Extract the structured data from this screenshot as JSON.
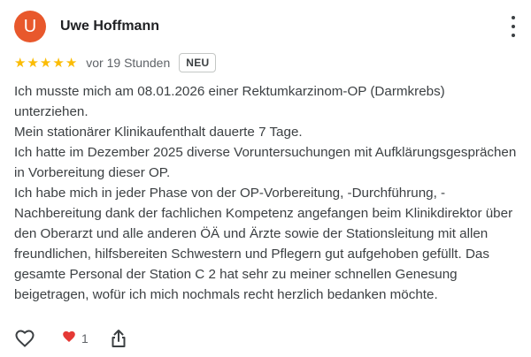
{
  "review": {
    "author_initial": "U",
    "author_name": "Uwe Hoffmann",
    "avatar_color": "#e8582c",
    "rating": 5,
    "rating_max": 5,
    "time_ago": "vor 19 Stunden",
    "badge": "NEU",
    "text_lines": [
      "Ich musste mich am 08.01.2026 einer Rektumkarzinom-OP (Darmkrebs) unterziehen.",
      "Mein stationärer Klinikaufenthalt dauerte 7 Tage.",
      "Ich hatte im Dezember 2025 diverse Voruntersuchungen mit Aufklärungsgesprächen in Vorbereitung dieser OP.",
      "Ich habe mich in jeder Phase von der OP-Vorbereitung, -Durchführung, -Nachbereitung dank der fachlichen Kompetenz angefangen beim Klinikdirektor über den Oberarzt und alle anderen ÖÄ und Ärzte sowie der Stationsleitung mit allen freundlichen, hilfsbereiten Schwestern und Pflegern gut aufgehoben gefüllt. Das gesamte Personal der Station C 2 hat sehr zu meiner schnellen Genesung beigetragen, wofür ich mich nochmals recht herzlich bedanken möchte."
    ],
    "reactions": {
      "like_icon": "heart-outline-icon",
      "reaction_icon": "red-heart-icon",
      "reaction_count": "1",
      "share_icon": "share-icon"
    }
  }
}
